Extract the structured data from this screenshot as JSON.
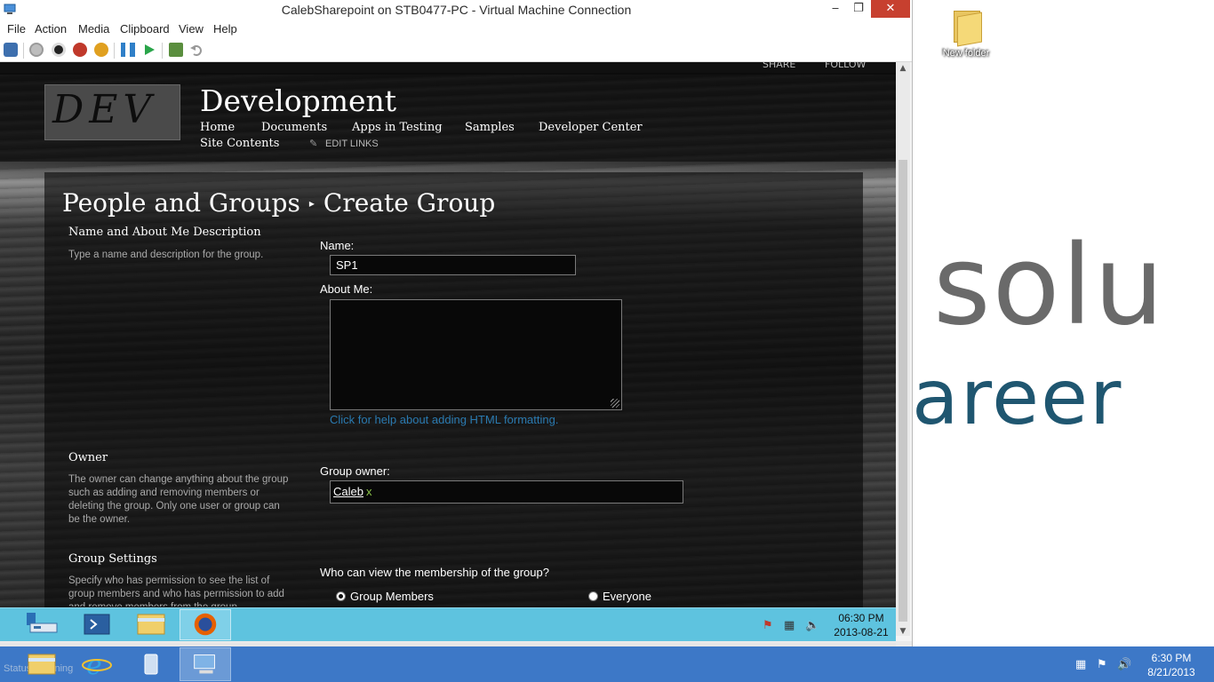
{
  "host": {
    "desktop_icon_label": "New folder",
    "wallpaper_line1": "solu",
    "wallpaper_line2": "areer",
    "status_text": "Status: Running",
    "clock_time": "6:30 PM",
    "clock_date": "8/21/2013"
  },
  "vm_window": {
    "title": "CalebSharepoint on STB0477-PC - Virtual Machine Connection",
    "minimize": "‒",
    "maximize": "❐",
    "close": "✕",
    "menu": [
      "File",
      "Action",
      "Media",
      "Clipboard",
      "View",
      "Help"
    ]
  },
  "sharepoint": {
    "top_links": [
      "SHARE",
      "FOLLOW"
    ],
    "logo_text": "DEV",
    "site_title": "Development",
    "nav": [
      "Home",
      "Documents",
      "Apps in Testing",
      "Samples",
      "Developer Center",
      "Site Contents"
    ],
    "edit_links": "EDIT LINKS",
    "breadcrumb": [
      "People and Groups",
      "Create Group"
    ],
    "breadcrumb_sep": "▸",
    "sections": {
      "name_about": {
        "title": "Name and About Me Description",
        "description": "Type a name and description for the group.",
        "name_label": "Name:",
        "name_value": "SP1",
        "about_label": "About Me:",
        "about_value": "",
        "help_link": "Click for help about adding HTML formatting."
      },
      "owner": {
        "title": "Owner",
        "description": "The owner can change anything about the group such as adding and removing members or deleting the group. Only one user or group can be the owner.",
        "label": "Group owner:",
        "person": "Caleb",
        "remove": "x"
      },
      "settings": {
        "title": "Group Settings",
        "description": "Specify who has permission to see the list of group members and who has permission to add and remove members from the group.",
        "question": "Who can view the membership of the group?",
        "options": [
          "Group Members",
          "Everyone"
        ],
        "selected": "Group Members"
      }
    }
  },
  "guest": {
    "clock_time": "06:30 PM",
    "clock_date": "2013-08-21"
  }
}
